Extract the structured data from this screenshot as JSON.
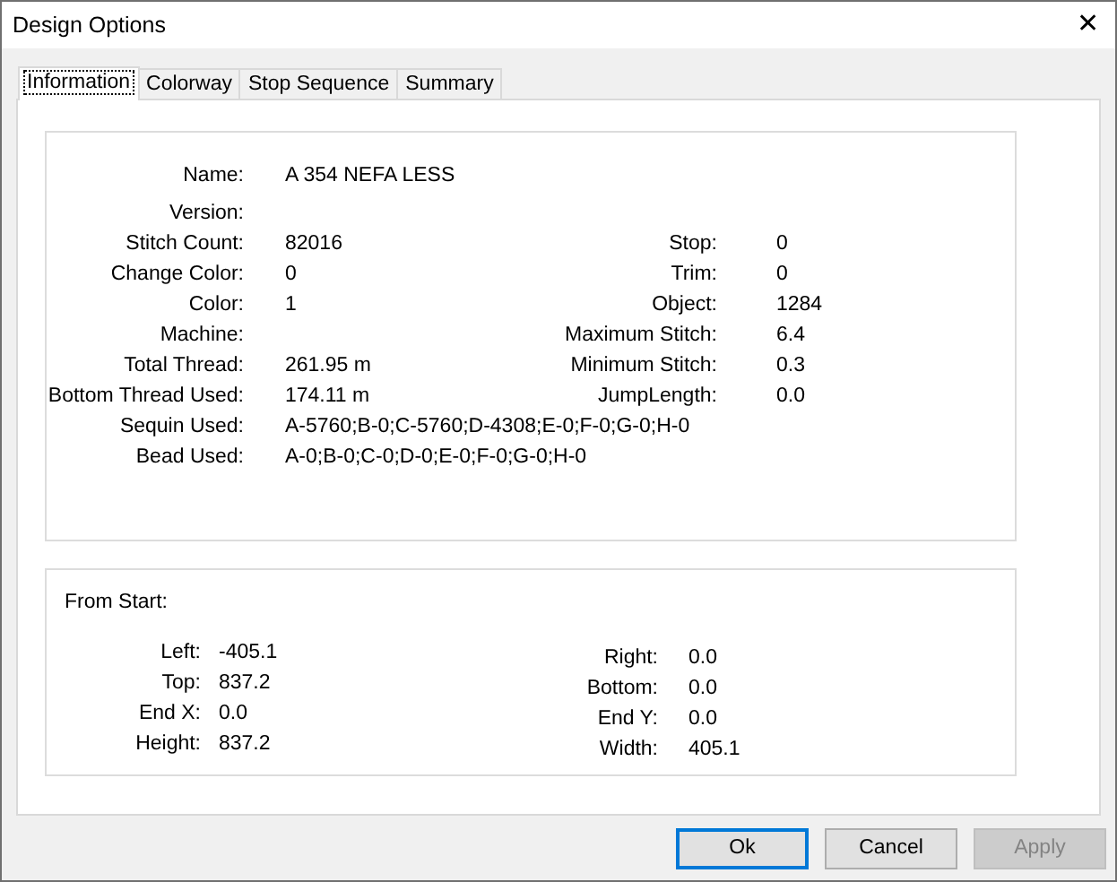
{
  "window": {
    "title": "Design Options",
    "close": "✕"
  },
  "tabs": [
    {
      "label": "Information",
      "selected": true
    },
    {
      "label": "Colorway",
      "selected": false
    },
    {
      "label": "Stop Sequence",
      "selected": false
    },
    {
      "label": "Summary",
      "selected": false
    }
  ],
  "info": {
    "rows": [
      {
        "label": "Name:",
        "value": "A 354 NEFA LESS"
      },
      {
        "label": "Version:"
      },
      {
        "label": "Stitch Count:",
        "value": "82016",
        "right": {
          "label": "Stop:",
          "value": "0"
        }
      },
      {
        "label": "Change Color:",
        "value": "0",
        "right": {
          "label": "Trim:",
          "value": "0"
        }
      },
      {
        "label": "Color:",
        "value": "1",
        "right": {
          "label": "Object:",
          "value": "1284"
        }
      },
      {
        "label": "Machine:",
        "right": {
          "label": "Maximum Stitch:",
          "value": "6.4"
        }
      },
      {
        "label": "Total Thread:",
        "value": "261.95 m",
        "right": {
          "label": "Minimum Stitch:",
          "value": "0.3"
        }
      },
      {
        "label": "Bottom Thread Used:",
        "value": "174.11 m",
        "right": {
          "label": "JumpLength:",
          "value": "0.0"
        }
      },
      {
        "label": "Sequin Used:",
        "value": "A-5760;B-0;C-5760;D-4308;E-0;F-0;G-0;H-0"
      },
      {
        "label": "Bead Used:",
        "value": "A-0;B-0;C-0;D-0;E-0;F-0;G-0;H-0"
      }
    ]
  },
  "from_start": {
    "title": "From Start:",
    "left": [
      {
        "label": "Left:",
        "value": "-405.1"
      },
      {
        "label": "Top:",
        "value": "837.2"
      },
      {
        "label": "End X:",
        "value": "0.0"
      },
      {
        "label": "Height:",
        "value": "837.2"
      }
    ],
    "right": [
      {
        "label": "Right:",
        "value": "0.0"
      },
      {
        "label": "Bottom:",
        "value": "0.0"
      },
      {
        "label": "End Y:",
        "value": "0.0"
      },
      {
        "label": "Width:",
        "value": "405.1"
      }
    ]
  },
  "buttons": [
    {
      "label": "Ok",
      "kind": "default",
      "disabled": false
    },
    {
      "label": "Cancel",
      "kind": "normal",
      "disabled": false
    },
    {
      "label": "Apply",
      "kind": "normal",
      "disabled": true
    }
  ]
}
